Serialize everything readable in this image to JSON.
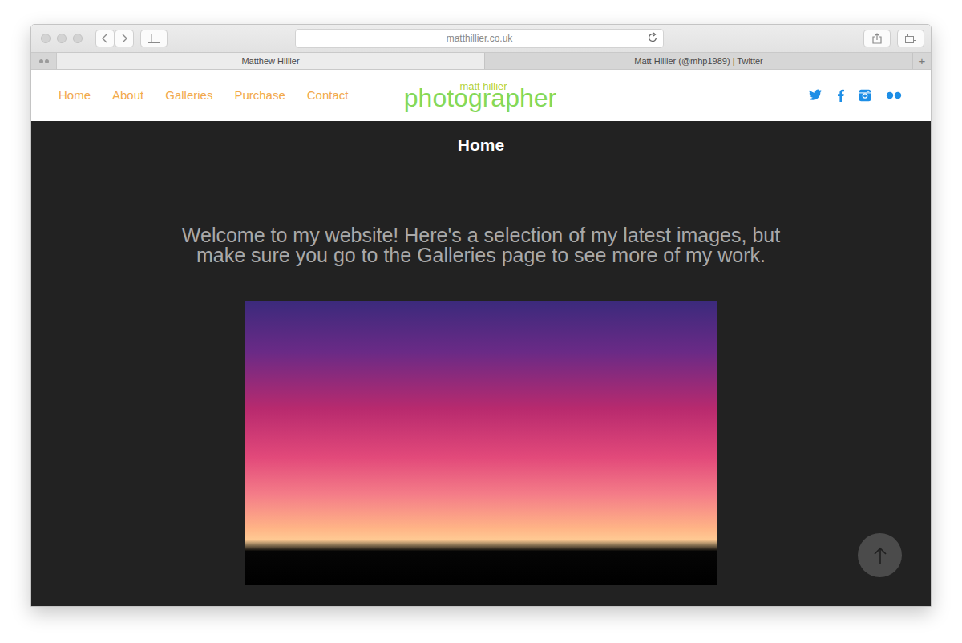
{
  "window": {
    "url": "matthillier.co.uk"
  },
  "tabs": [
    {
      "label": "Matthew Hillier",
      "selected": true
    },
    {
      "label": "Matt Hillier (@mhp1989) | Twitter",
      "selected": false
    }
  ],
  "tabbar": {
    "new_tab": "+"
  },
  "site": {
    "nav": [
      "Home",
      "About",
      "Galleries",
      "Purchase",
      "Contact"
    ],
    "logo": {
      "top": "matt hillier",
      "bottom": "photographer"
    },
    "page_title": "Home",
    "intro": "Welcome to my website! Here's a selection of my latest images, but make sure you go to the Galleries page to see more of my work."
  }
}
